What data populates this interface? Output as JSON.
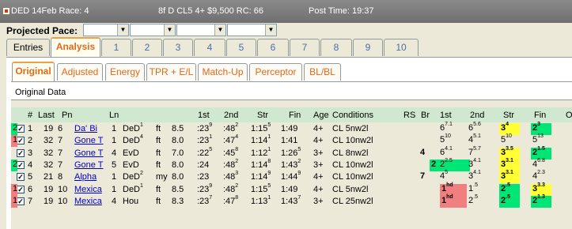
{
  "window": {
    "race_id": "DED 14Feb Race: 4",
    "race_info": "8f  D  CL5  4+  $9,500  RC: 66",
    "post_time": "Post Time: 19:37"
  },
  "pace": {
    "label": "Projected Pace:"
  },
  "main_tabs": [
    "Entries",
    "Analysis",
    "1",
    "2",
    "3",
    "4",
    "5",
    "6",
    "7",
    "8",
    "9",
    "10"
  ],
  "sub_tabs": [
    "Original",
    "Adjusted",
    "Energy",
    "TPR + E/L",
    "Match-Up",
    "Perceptor",
    "BL/BL"
  ],
  "section_label": "Original Data",
  "columns": [
    "#",
    "Last",
    "Pn",
    "Ln",
    "1st",
    "2nd",
    "Str",
    "Fin",
    "Age",
    "Conditions",
    "RS",
    "Br",
    "1st",
    "2nd",
    "Str",
    "Fin",
    "O"
  ],
  "rows": [
    {
      "num": "1",
      "last": "19",
      "pn": "6",
      "name": "Da' Bi",
      "ln": "1",
      "trk": "DeD",
      "trk_sup": "1",
      "cond": "ft",
      "dist": "8.5",
      "f1": ":23",
      "f1s": "9",
      "f2": ":48",
      "f2s": "2",
      "str": "1:15",
      "strs": "5",
      "fin": "1:49",
      "fins": "",
      "age": "4+",
      "cls": "CL 5nw2l",
      "rs": "2",
      "rs_color": "#00e676",
      "br": "",
      "b1": "6",
      "b1s": "7.1",
      "b2": "6",
      "b2s": "5.6",
      "bs": "3",
      "bss": "4",
      "bs_color": "#ffff33",
      "bf": "2",
      "bfs": "3",
      "bf_color": "#00e676"
    },
    {
      "num": "2",
      "last": "32",
      "pn": "7",
      "name": "Gone T",
      "ln": "1",
      "trk": "DeD",
      "trk_sup": "4",
      "cond": "ft",
      "dist": "8.0",
      "f1": ":23",
      "f1s": "1",
      "f2": ":47",
      "f2s": "4",
      "str": "1:14",
      "strs": "1",
      "fin": "1:41",
      "fins": "",
      "age": "4+",
      "cls": "CL 10nw2l",
      "rs": "1",
      "rs_color": "#f08080",
      "br": "",
      "b1": "5",
      "b1s": "10",
      "b2": "4",
      "b2s": "5.1",
      "bs": "5",
      "bss": "10",
      "bs_color": "",
      "bf": "5",
      "bfs": "13",
      "bf_color": ""
    },
    {
      "num": "3",
      "last": "32",
      "pn": "7",
      "name": "Gone T",
      "ln": "4",
      "trk": "EvD",
      "trk_sup": "",
      "cond": "ft",
      "dist": "7.0",
      "f1": ":22",
      "f1s": "5",
      "f2": ":45",
      "f2s": "8",
      "str": "1:12",
      "strs": "1",
      "fin": "1:26",
      "fins": "5",
      "age": "3+",
      "cls": "CL 8nw2l",
      "rs": "4",
      "rs_color": "",
      "br": "",
      "b1": "6",
      "b1s": "4.1",
      "b2": "7",
      "b2s": "5.7",
      "bs": "3",
      "bss": "3.5",
      "bs_color": "#ffff33",
      "bf": "2",
      "bfs": "1.5",
      "bf_color": "#00e676"
    },
    {
      "num": "4",
      "last": "32",
      "pn": "7",
      "name": "Gone T",
      "ln": "5",
      "trk": "EvD",
      "trk_sup": "",
      "cond": "ft",
      "dist": "8.0",
      "f1": ":24",
      "f1s": "",
      "f2": ":48",
      "f2s": "2",
      "str": "1:14",
      "strs": "8",
      "fin": "1:43",
      "fins": "2",
      "age": "3+",
      "cls": "CL 10nw2l",
      "rs": "2",
      "rs_color": "#00e676",
      "br": "2",
      "b1": "2",
      "b1s": "2.5",
      "b2": "3",
      "b2s": "4.1",
      "bs": "3",
      "bss": "3.1",
      "bs_color": "#ffff33",
      "bf": "4",
      "bfs": "6.8",
      "bf_color": ""
    },
    {
      "num": "5",
      "last": "21",
      "pn": "8",
      "name": "Alpha",
      "ln": "1",
      "trk": "DeD",
      "trk_sup": "2",
      "cond": "my",
      "dist": "8.0",
      "f1": ":23",
      "f1s": "",
      "f2": ":48",
      "f2s": "3",
      "str": "1:14",
      "strs": "9",
      "fin": "1:44",
      "fins": "9",
      "age": "4+",
      "cls": "CL 10nw2l",
      "rs": "7",
      "rs_color": "",
      "br": "",
      "b1": "4",
      "b1s": "5",
      "b2": "3",
      "b2s": "4.1",
      "bs": "3",
      "bss": "3.1",
      "bs_color": "#ffff33",
      "bf": "4",
      "bfs": "2.3",
      "bf_color": ""
    },
    {
      "num": "6",
      "last": "19",
      "pn": "10",
      "name": "Mexica",
      "ln": "1",
      "trk": "DeD",
      "trk_sup": "1",
      "cond": "ft",
      "dist": "8.5",
      "f1": ":23",
      "f1s": "9",
      "f2": ":48",
      "f2s": "2",
      "str": "1:15",
      "strs": "5",
      "fin": "1:49",
      "fins": "",
      "age": "4+",
      "cls": "CL 5nw2l",
      "rs": "1",
      "rs_color": "#f08080",
      "br": "",
      "b1": "1",
      "b1s": "hd",
      "b2": "1",
      "b2s": ".5",
      "bs": "2",
      "bss": ".5",
      "bs_color": "#00e676",
      "bf": "3",
      "bfs": "3.3",
      "bf_color": "#ffff33"
    },
    {
      "num": "7",
      "last": "19",
      "pn": "10",
      "name": "Mexica",
      "ln": "4",
      "trk": "Hou",
      "trk_sup": "",
      "cond": "ft",
      "dist": "8.3",
      "f1": ":23",
      "f1s": "7",
      "f2": ":47",
      "f2s": "8",
      "str": "1:13",
      "strs": "1",
      "fin": "1:43",
      "fins": "7",
      "age": "3+",
      "cls": "CL 25nw2l",
      "rs": "1",
      "rs_color": "#f08080",
      "br": "",
      "b1": "1",
      "b1s": "hd",
      "b2": "2",
      "b2s": ".5",
      "bs": "2",
      "bss": ".5",
      "bs_color": "#00e676",
      "bf": "2",
      "bfs": "1.3",
      "bf_color": "#00e676"
    }
  ]
}
